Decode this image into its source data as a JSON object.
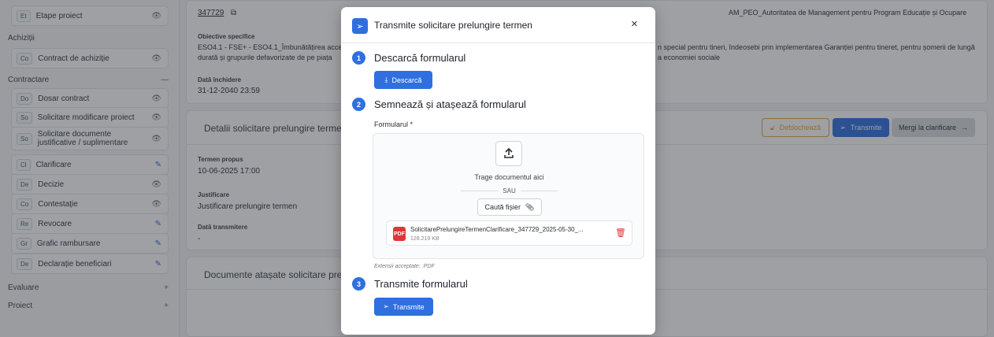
{
  "sidebar": {
    "rows": [
      {
        "kind": "item",
        "abbr": "Et",
        "label": "Etape proiect",
        "icon": "eye-icon"
      },
      {
        "kind": "group",
        "label": "Achiziții",
        "icon": ""
      },
      {
        "kind": "item",
        "abbr": "Co",
        "label": "Contract de achiziție",
        "icon": "eye-icon"
      },
      {
        "kind": "group",
        "label": "Contractare",
        "icon": "minus-icon"
      },
      {
        "kind": "item",
        "abbr": "Do",
        "label": "Dosar contract",
        "icon": "eye-icon"
      },
      {
        "kind": "item",
        "abbr": "So",
        "label": "Solicitare modificare proiect",
        "icon": "eye-icon"
      },
      {
        "kind": "item",
        "abbr": "So",
        "label": "Solicitare documente justificative / suplimentare",
        "icon": "eye-icon"
      },
      {
        "kind": "item",
        "abbr": "Cl",
        "label": "Clarificare",
        "icon": "edit-icon"
      },
      {
        "kind": "item",
        "abbr": "De",
        "label": "Decizie",
        "icon": "eye-icon"
      },
      {
        "kind": "item",
        "abbr": "Co",
        "label": "Contestație",
        "icon": "eye-icon"
      },
      {
        "kind": "item",
        "abbr": "Re",
        "label": "Revocare",
        "icon": "edit-icon"
      },
      {
        "kind": "item",
        "abbr": "Gr",
        "label": "Grafic rambursare",
        "icon": "edit-icon"
      },
      {
        "kind": "item",
        "abbr": "De",
        "label": "Declarație beneficiari",
        "icon": "edit-icon"
      },
      {
        "kind": "group",
        "label": "Evaluare",
        "icon": "plus-icon"
      },
      {
        "kind": "group",
        "label": "Proiect",
        "icon": "plus-icon"
      }
    ]
  },
  "main": {
    "project_code": "347729",
    "authority": "AM_PEO_Autoritatea de Management pentru Program Educație și Ocupare",
    "objectives_label": "Obiective specifice",
    "objectives_text_l1": "ESO4.1 - FSE+ - ESO4.1_Îmbunătățirea acce",
    "objectives_text_l2": "durată și grupurile defavorizate de pe piața",
    "objectives_right_l1": "n special pentru tineri, îndeosebi prin implementarea Garanției pentru tineret, pentru șomerii de lungă",
    "objectives_right_l2": "a economiei sociale",
    "closing_label": "Dată închidere",
    "closing_value": "31-12-2040 23:59",
    "details_title": "Detalii solicitare prelungire termen clari",
    "unlock_label": "Deblochează",
    "send_label": "Transmite",
    "goto_label": "Mergi la clarificare",
    "term_label": "Termen propus",
    "term_value": "10-06-2025 17:00",
    "just_label": "Justificare",
    "just_value": "Justificare prelungire termen",
    "sent_label": "Dată transmitere",
    "sent_value": "-",
    "docs_title": "Documente atașate solicitare prelungire"
  },
  "modal": {
    "title": "Transmite solicitare prelungire termen",
    "close": "×",
    "step1_num": "1",
    "step1_title": "Descarcă formularul",
    "download_label": "Descarcă",
    "step2_num": "2",
    "step2_title": "Semnează și atașează formularul",
    "form_label": "Formularul *",
    "drop_text": "Trage documentul aici",
    "or_text": "SAU",
    "browse_label": "Caută fișier",
    "file_name": "SolicitarePrelungireTermenClarificare_347729_2025-05-30_...",
    "file_size": "128.219 KB",
    "accepted": "Extensii acceptate: .PDF",
    "step3_num": "3",
    "step3_title": "Transmite formularul",
    "submit_label": "Transmite"
  },
  "colors": {
    "primary": "#2f6fe0",
    "warning": "#e8a33d",
    "danger": "#e0353b"
  }
}
